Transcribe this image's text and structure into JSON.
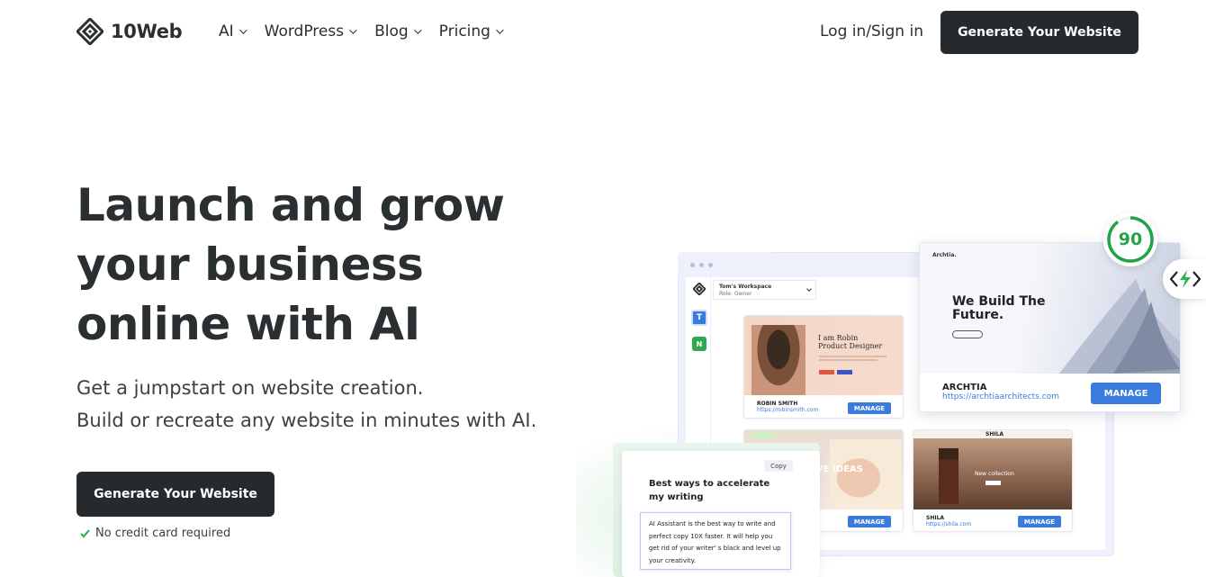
{
  "nav": {
    "logo_text": "10Web",
    "menu": [
      "AI",
      "WordPress",
      "Blog",
      "Pricing"
    ],
    "login": "Log in/Sign in",
    "cta": "Generate Your Website"
  },
  "hero": {
    "title_lines": [
      "Launch and grow",
      "your business",
      "online with AI"
    ],
    "sub1": "Get a jumpstart on website creation.",
    "sub2": "Build or recreate any website in minutes with AI.",
    "cta": "Generate Your Website",
    "no_cc": "No credit card required"
  },
  "dashboard": {
    "workspace": "Tom's Workspace",
    "role": "Role: Owner",
    "side_t": "T",
    "side_n": "N",
    "score": "90",
    "robin": {
      "headline1": "I am Robin",
      "headline2": "Product Designer",
      "name": "ROBIN SMITH",
      "url": "https://robinsmith.com",
      "manage": "MANAGE"
    },
    "archtia": {
      "brand": "Archtia.",
      "headline1": "We Build The",
      "headline2": "Future.",
      "name": "ARCHTIA",
      "url": "https://archtiaarchitects.com",
      "manage": "MANAGE"
    },
    "ideas": {
      "overlay": "VE IDEAS",
      "manage": "MANAGE"
    },
    "shila": {
      "brand": "SHILA",
      "overlay": "New collection",
      "name": "SHILA",
      "url": "https://shila.com",
      "manage": "MANAGE"
    },
    "ai": {
      "copy": "Copy",
      "title1": "Best ways to accelerate",
      "title2": "my writing",
      "body": [
        "AI Assistant is the best way to write and",
        "perfect copy 10X faster. It will help you",
        "get rid of your writer' s black and level up",
        "your creativity."
      ]
    }
  },
  "colors": {
    "dark": "#262a2c",
    "accent_blue": "#3a7be0",
    "score_green": "#22a34a",
    "check_green": "#2fa84f"
  }
}
